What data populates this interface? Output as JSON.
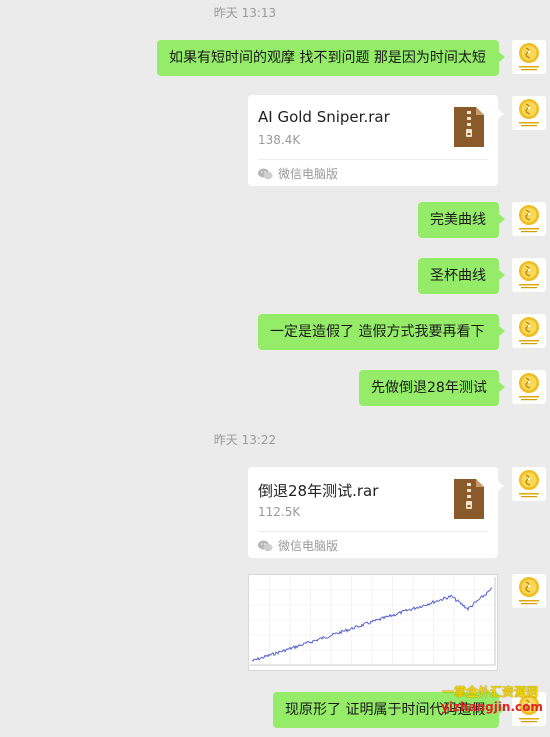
{
  "timestamps": [
    "昨天 13:13",
    "昨天 13:22"
  ],
  "messages": {
    "m1": "如果有短时间的观摩 找不到问题 那是因为时间太短",
    "m2": "完美曲线",
    "m3": "圣杯曲线",
    "m4": "一定是造假了 造假方式我要再看下",
    "m5": "先做倒退28年测试",
    "m6": "现原形了 证明属于时间代码造假"
  },
  "files": [
    {
      "name": "AI Gold Sniper.rar",
      "size": "138.4K",
      "source": "微信电脑版",
      "icon": "zip-file-icon"
    },
    {
      "name": "倒退28年测试.rar",
      "size": "112.5K",
      "source": "微信电脑版",
      "icon": "zip-file-icon"
    }
  ],
  "avatar": {
    "caption": "一掌金",
    "icon": "gold-coin-logo-icon"
  },
  "watermark": {
    "line1": "一掌金外汇资源网",
    "line2": "yizhangjin.com"
  },
  "colors": {
    "self_bubble": "#95ec69",
    "background": "#ebebeb",
    "file_card": "#ffffff",
    "zip_icon": "#8b5a2b"
  },
  "equity_curve": {
    "trend": "rising",
    "dip_near_end": true
  }
}
